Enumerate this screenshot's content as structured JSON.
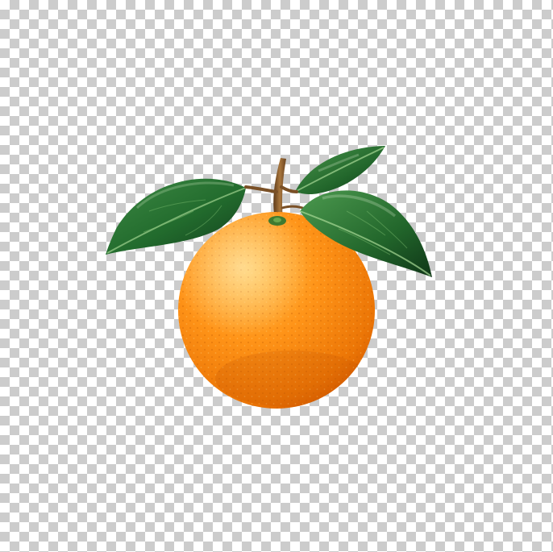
{
  "image": {
    "subject": "orange-with-leaves",
    "background": "transparency-checkerboard",
    "colors": {
      "checker_light": "#ffffff",
      "checker_dark": "#cccccc",
      "peel_highlight": "#ffc04a",
      "peel_mid": "#ff9418",
      "peel_shadow": "#d95f00",
      "leaf_light": "#3e8b45",
      "leaf_dark": "#123d1c",
      "stem": "#8a5b2b",
      "calyx": "#3f7a30"
    }
  }
}
